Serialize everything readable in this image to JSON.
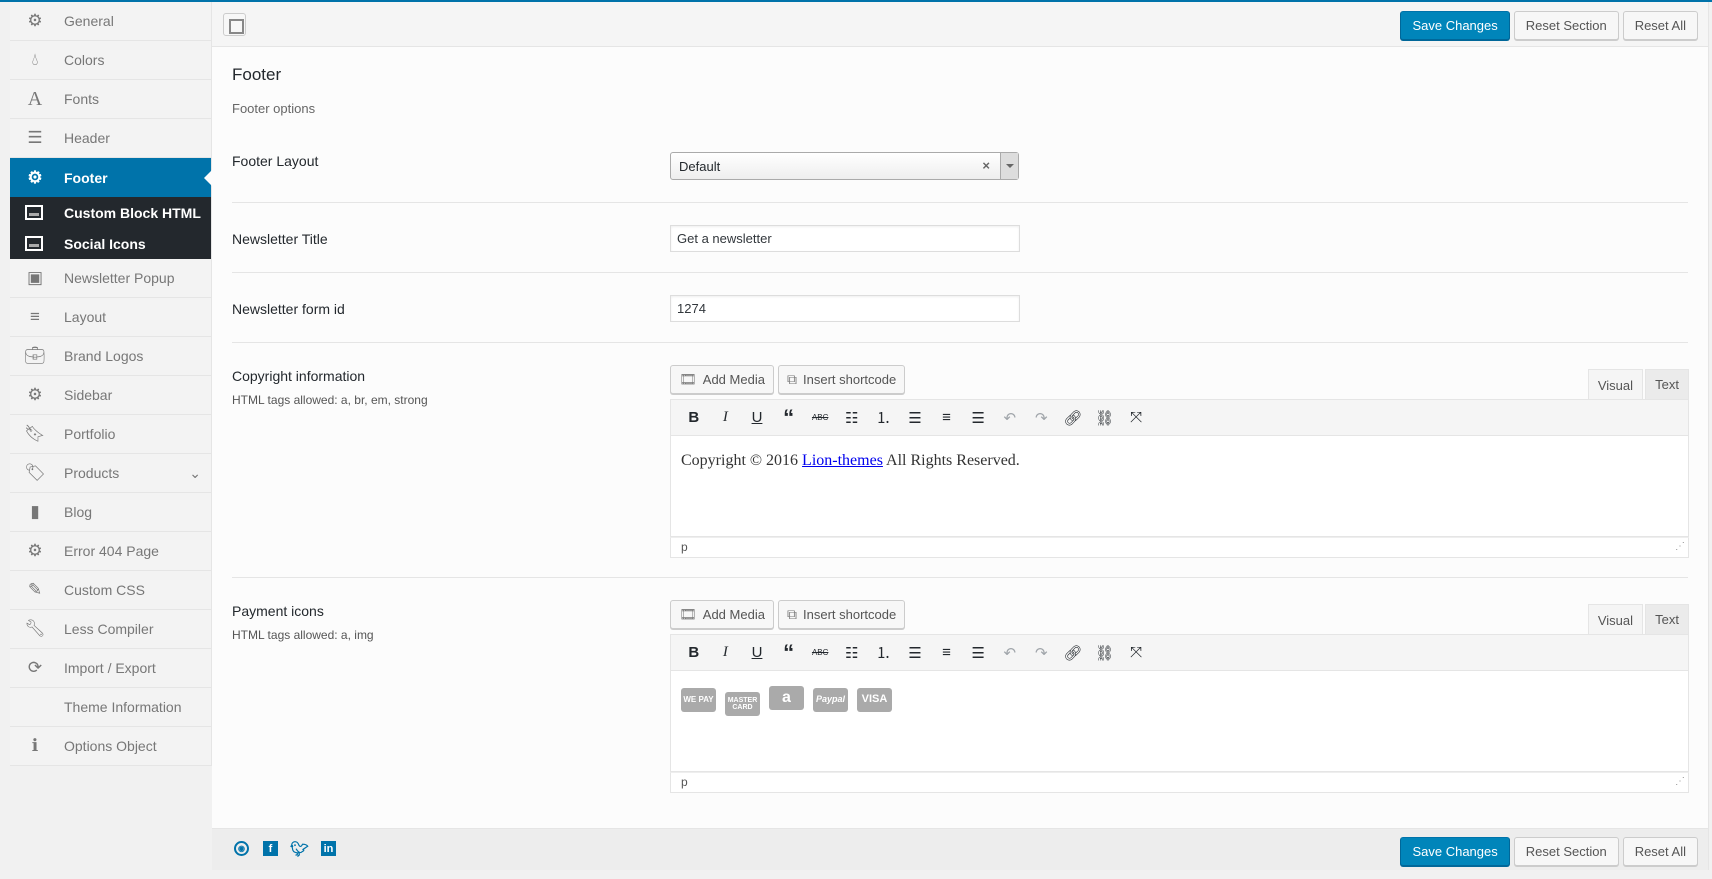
{
  "colors": {
    "accent": "#0073aa",
    "submenu_bg": "#23282d",
    "primary_button": "#0085ba"
  },
  "sidebar": {
    "items": [
      {
        "label": "General",
        "icon": "gear-icon"
      },
      {
        "label": "Colors",
        "icon": "drop-icon"
      },
      {
        "label": "Fonts",
        "icon": "font-icon"
      },
      {
        "label": "Header",
        "icon": "header-icon"
      },
      {
        "label": "Footer",
        "icon": "gear-icon",
        "active": true
      },
      {
        "label": "Newsletter Popup",
        "icon": "window-icon"
      },
      {
        "label": "Layout",
        "icon": "bars-icon"
      },
      {
        "label": "Brand Logos",
        "icon": "briefcase-icon"
      },
      {
        "label": "Sidebar",
        "icon": "gear-icon"
      },
      {
        "label": "Portfolio",
        "icon": "bookmark-icon"
      },
      {
        "label": "Products",
        "icon": "tags-icon",
        "expandable": true
      },
      {
        "label": "Blog",
        "icon": "book-icon"
      },
      {
        "label": "Error 404 Page",
        "icon": "gear-icon"
      },
      {
        "label": "Custom CSS",
        "icon": "pencil-icon"
      },
      {
        "label": "Less Compiler",
        "icon": "wrench-icon"
      },
      {
        "label": "Import / Export",
        "icon": "refresh-icon"
      },
      {
        "label": "Theme Information",
        "icon": ""
      },
      {
        "label": "Options Object",
        "icon": "info-icon"
      }
    ],
    "subitems": [
      {
        "label": "Custom Block HTML"
      },
      {
        "label": "Social Icons"
      }
    ]
  },
  "toolbar": {
    "save": "Save Changes",
    "reset_section": "Reset Section",
    "reset_all": "Reset All"
  },
  "section": {
    "title": "Footer",
    "description": "Footer options"
  },
  "fields": {
    "footer_layout": {
      "label": "Footer Layout",
      "value": "Default"
    },
    "newsletter_title": {
      "label": "Newsletter Title",
      "value": "Get a newsletter"
    },
    "newsletter_form_id": {
      "label": "Newsletter form id",
      "value": "1274"
    },
    "copyright": {
      "label": "Copyright information",
      "help": "HTML tags allowed: a, br, em, strong",
      "text_before": "Copyright © 2016 ",
      "link": "Lion-themes",
      "text_after": " All Rights Reserved.",
      "path": "p"
    },
    "payment": {
      "label": "Payment icons",
      "help": "HTML tags allowed: a, img",
      "icons": [
        "WE PAY",
        "MASTER CARD",
        "a",
        "Paypal",
        "VISA"
      ],
      "path": "p"
    }
  },
  "editor": {
    "add_media": "Add Media",
    "insert_shortcode": "Insert shortcode",
    "tab_visual": "Visual",
    "tab_text": "Text"
  }
}
